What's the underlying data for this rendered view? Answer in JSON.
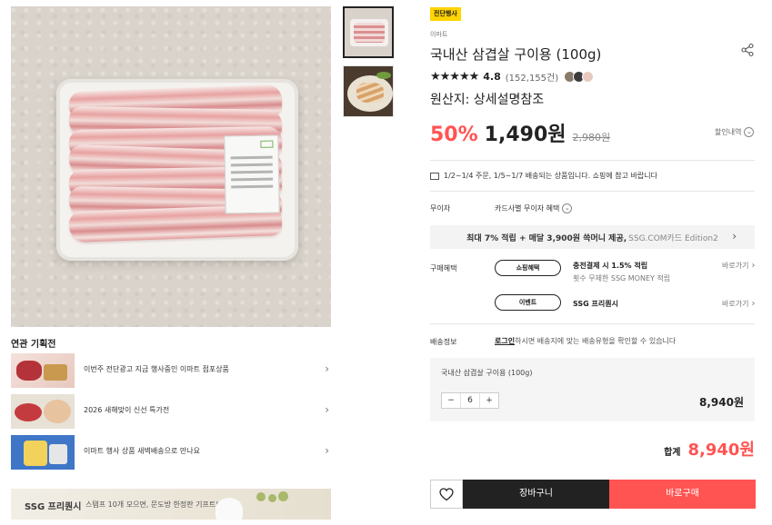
{
  "gallery": {
    "thumbnails": [
      "product-package-photo",
      "cooked-dish-photo"
    ]
  },
  "related": {
    "title": "연관 기획전",
    "items": [
      {
        "label": "이번주 전단광고 지금 행사중인 이마트 점포상품"
      },
      {
        "label": "2026 새해맞이 신선 특가전"
      },
      {
        "label": "이마트 행사 상품 새벽배송으로 만나요"
      }
    ]
  },
  "banner": {
    "brand": "SSG 프리퀀시",
    "subtitle": "스탬프 10개 모으면, 문도방 한정판 기프트!"
  },
  "product": {
    "badge": "전단행사",
    "brand": "이마트",
    "title": "국내산 삼겹살 구이용 (100g)",
    "stars": "★★★★★",
    "rating": "4.8",
    "review_count": "(152,155건)",
    "origin": "원산지: 상세설명참조",
    "discount_rate": "50%",
    "price": "1,490원",
    "original_price": "2,980원",
    "discount_detail": "할인내역"
  },
  "delivery_notice": "1/2~1/4 주문, 1/5~1/7 배송되는 상품입니다. 쇼핑에 참고 바랍니다",
  "interest_free": {
    "label": "무이자",
    "value": "카드사별 무이자 혜택"
  },
  "card_banner": {
    "bold": "최대 7% 적립 + 매달 3,900원 쓱머니 제공,",
    "muted": "SSG.COM카드 Edition2"
  },
  "purchase_benefits": {
    "label": "구매혜택",
    "items": [
      {
        "pill": "쇼핑혜택",
        "title": "충전결제 시 1.5% 적립",
        "sub": "횟수 무제한 SSG MONEY 적립",
        "link": "바로가기"
      },
      {
        "pill": "이벤트",
        "title": "SSG 프리퀀시",
        "link": "바로가기"
      }
    ]
  },
  "shipping": {
    "label": "배송정보",
    "login": "로그인",
    "text": "하시면 배송지에 맞는 배송유형을 확인할 수 있습니다"
  },
  "option": {
    "name": "국내산 삼겹살 구이용 (100g)",
    "minus": "−",
    "quantity": "6",
    "plus": "+",
    "price": "8,940원"
  },
  "total": {
    "label": "합계",
    "value": "8,940원"
  },
  "actions": {
    "cart": "장바구니",
    "buy": "바로구매"
  },
  "colors": {
    "accent": "#ff5452",
    "badge": "#ffd400",
    "dark": "#222222"
  }
}
